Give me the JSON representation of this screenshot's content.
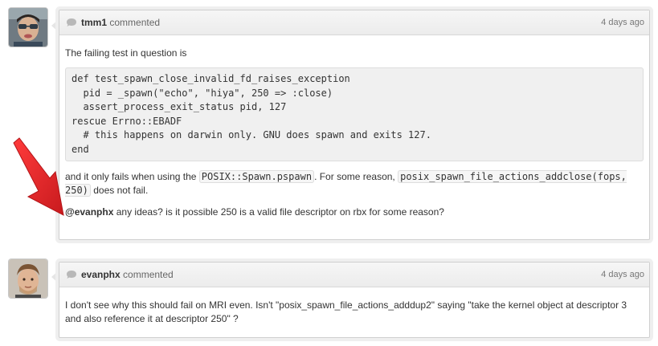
{
  "comments": [
    {
      "author": "tmm1",
      "action": "commented",
      "timestamp": "4 days ago",
      "intro": "The failing test in question is",
      "code_lines": [
        "def test_spawn_close_invalid_fd_raises_exception",
        "  pid = _spawn(\"echo\", \"hiya\", 250 => :close)",
        "  assert_process_exit_status pid, 127",
        "rescue Errno::EBADF",
        "  # this happens on darwin only. GNU does spawn and exits 127.",
        "end"
      ],
      "para2": {
        "pre": "and it only fails when using the ",
        "code1": "POSIX::Spawn.pspawn",
        "mid": ". For some reason, ",
        "code2": "posix_spawn_file_actions_addclose(fops, 250)",
        "post": " does not fail."
      },
      "para3": {
        "mention": "@evanphx",
        "text": " any ideas? is it possible 250 is a valid file descriptor on rbx for some reason?"
      }
    },
    {
      "author": "evanphx",
      "action": "commented",
      "timestamp": "4 days ago",
      "body": "I don't see why this should fail on MRI even. Isn't \"posix_spawn_file_actions_adddup2\" saying \"take the kernel object at descriptor 3 and also reference it at descriptor 250\" ?"
    }
  ],
  "colors": {
    "annotation_arrow": "#e8262a",
    "bubble_icon": "#b8b8b8"
  },
  "icons": {
    "comment": "speech-bubble-icon",
    "annotation": "red-arrow"
  }
}
